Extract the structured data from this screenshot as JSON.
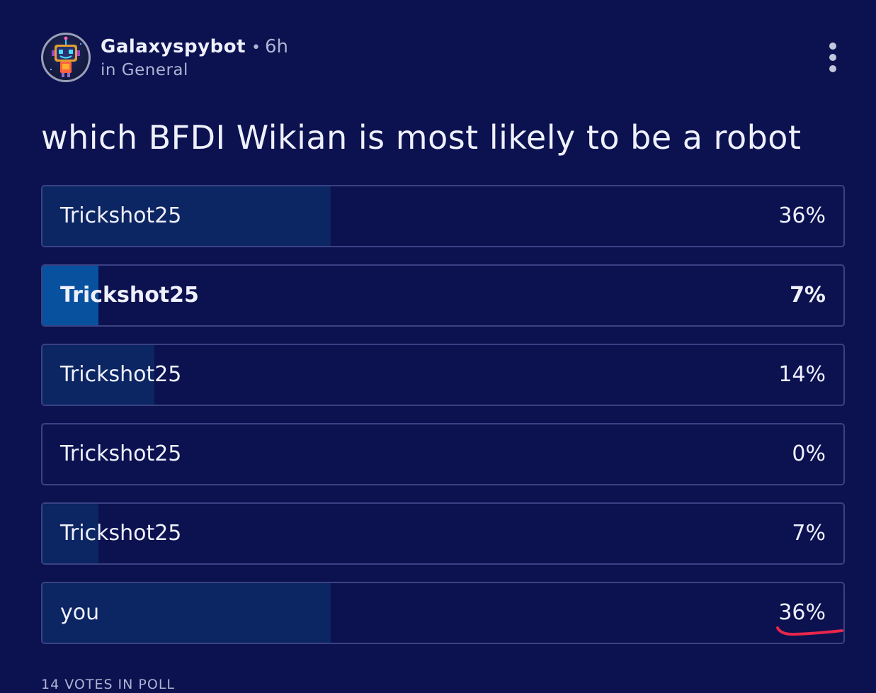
{
  "post": {
    "author": "Galaxyspybot",
    "separator": "•",
    "time": "6h",
    "category": "in General",
    "more_icon": "vertical-ellipsis-icon"
  },
  "poll": {
    "question": "which BFDI Wikian is most likely to be a robot",
    "options": [
      {
        "label": "Trickshot25",
        "percent_text": "36%",
        "percent": 36,
        "selected": false
      },
      {
        "label": "Trickshot25",
        "percent_text": "7%",
        "percent": 7,
        "selected": true
      },
      {
        "label": "Trickshot25",
        "percent_text": "14%",
        "percent": 14,
        "selected": false
      },
      {
        "label": "Trickshot25",
        "percent_text": "0%",
        "percent": 0,
        "selected": false
      },
      {
        "label": "Trickshot25",
        "percent_text": "7%",
        "percent": 7,
        "selected": false
      },
      {
        "label": "you",
        "percent_text": "36%",
        "percent": 36,
        "selected": false
      }
    ],
    "footer": "14 VOTES IN POLL"
  },
  "colors": {
    "background": "#0c1150",
    "bar_fill": "#0c2563",
    "bar_fill_selected": "#07519f",
    "option_border": "#3a4284",
    "annotation_red": "#e8274a"
  }
}
